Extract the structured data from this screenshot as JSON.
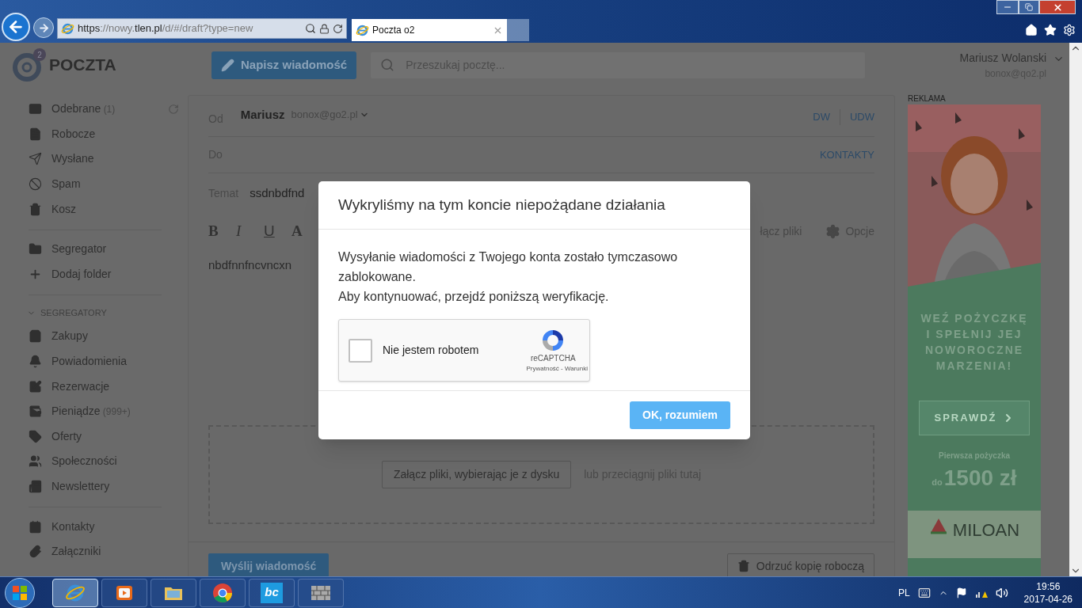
{
  "browser": {
    "url": "**https**://nowy.**tlen.pl**/d/#/draft?type=new",
    "tab": {
      "title": "Poczta o2",
      "selected": true
    }
  },
  "header": {
    "logo_sup": "2",
    "logo_text": "POCZTA",
    "compose_button": "Napisz wiadomość",
    "search": {
      "placeholder": "Przeszukaj pocztę..."
    },
    "user_name": "Mariusz Wolanski",
    "user_email": "bonox@qo2.pl"
  },
  "sidebar": {
    "groups": [
      {
        "items": [
          {
            "label": "Odebrane",
            "count": "(1)"
          },
          {
            "label": "Robocze"
          },
          {
            "label": "Wysłane"
          },
          {
            "label": "Spam"
          },
          {
            "label": "Kosz"
          }
        ]
      },
      {
        "items": [
          {
            "label": "Segregator"
          },
          {
            "label": "Dodaj folder"
          }
        ]
      },
      {
        "heading": "SEGREGATORY",
        "expanded": true,
        "items": [
          {
            "label": "Zakupy"
          },
          {
            "label": "Powiadomienia"
          },
          {
            "label": "Rezerwacje"
          },
          {
            "label": "Pieniądze",
            "count": "(999+)"
          },
          {
            "label": "Oferty"
          },
          {
            "label": "Społeczności"
          },
          {
            "label": "Newslettery"
          }
        ]
      },
      {
        "items": [
          {
            "label": "Kontakty"
          },
          {
            "label": "Załączniki"
          }
        ]
      }
    ]
  },
  "compose": {
    "from_label": "Od",
    "from_name": "Mariusz",
    "from_email": "bonox@go2.pl",
    "cc": "DW",
    "bcc": "UDW",
    "to_label": "Do",
    "contacts": "KONTAKTY",
    "subject_label": "Temat",
    "subject": "ssdnbdfnd",
    "format_buttons": [
      "B",
      "I",
      "U",
      "A"
    ],
    "attach_link": "łącz pliki",
    "options": "Opcje",
    "body": "nbdfnnfncvncxn",
    "attach_button": "Załącz pliki, wybierając je z dysku",
    "drop_hint": "lub przeciągnij pliki tutaj",
    "send_button": "Wyślij wiadomość",
    "discard_button": "Odrzuć kopię roboczą"
  },
  "ad": {
    "label": "REKLAMA",
    "headline": [
      "WEŹ POŻYCZKĘ",
      "I SPEŁNIJ JEJ",
      "NOWOROCZNE",
      "MARZENIA!"
    ],
    "button": "SPRAWDŹ",
    "caption": "Pierwsza pożyczka",
    "amount_prefix": "do",
    "amount": "1500 zł",
    "brand": "MILOAN"
  },
  "modal": {
    "title": "Wykryliśmy na tym koncie niepożądane działania",
    "paragraphs": [
      "Wysyłanie wiadomości z Twojego konta zostało tymczasowo zablokowane.",
      "Aby kontynuować, przejdź poniższą weryfikację."
    ],
    "captcha": {
      "label": "Nie jestem robotem",
      "checked": false,
      "brand": "reCAPTCHA",
      "links": "Prywatność - Warunki"
    },
    "ok_button": "OK, rozumiem"
  },
  "taskbar": {
    "apps": [
      {
        "kind": "ie",
        "selected": true
      },
      {
        "kind": "media",
        "selected": false
      },
      {
        "kind": "explorer",
        "selected": false
      },
      {
        "kind": "chrome",
        "selected": false
      },
      {
        "kind": "bc",
        "selected": false
      },
      {
        "kind": "firewall",
        "selected": false
      }
    ],
    "bc_label": "bc",
    "language": "PL",
    "time": "19:56",
    "date": "2017-04-26"
  }
}
